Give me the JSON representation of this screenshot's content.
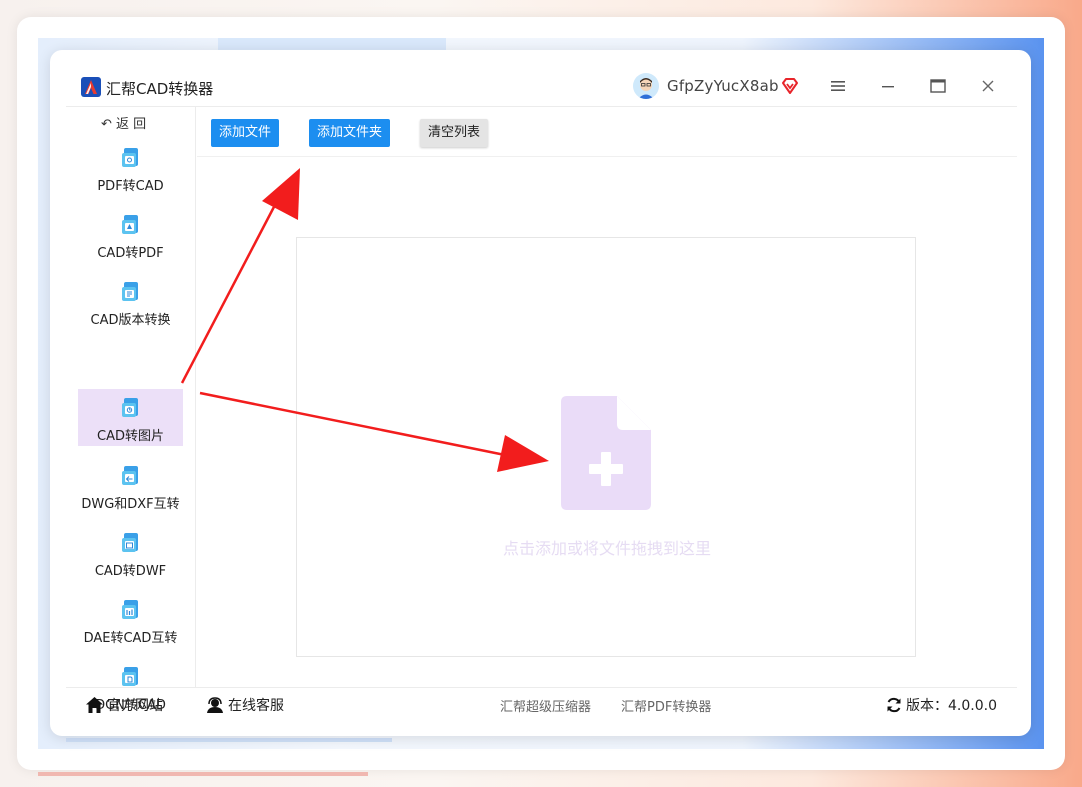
{
  "app": {
    "title": "汇帮CAD转换器",
    "user_name": "GfpZyYucX8ab"
  },
  "sidebar": {
    "back_label": "返 回",
    "items": [
      {
        "label": "PDF转CAD",
        "icon": "pdf-to-cad-icon"
      },
      {
        "label": "CAD转PDF",
        "icon": "cad-to-pdf-icon"
      },
      {
        "label": "CAD版本转换",
        "icon": "cad-version-icon"
      },
      {
        "label": "CAD转图片",
        "icon": "cad-to-image-icon",
        "active": true
      },
      {
        "label": "DWG和DXF互转",
        "icon": "dwg-dxf-icon"
      },
      {
        "label": "CAD转DWF",
        "icon": "cad-to-dwf-icon"
      },
      {
        "label": "DAE转CAD互转",
        "icon": "dae-cad-icon"
      },
      {
        "label": "DGN转CAD",
        "icon": "dgn-to-cad-icon"
      }
    ]
  },
  "toolbar": {
    "add_file": "添加文件",
    "add_folder": "添加文件夹",
    "clear_list": "清空列表"
  },
  "dropzone": {
    "hint": "点击添加或将文件拖拽到这里"
  },
  "footer": {
    "website": "官方网站",
    "support": "在线客服",
    "link1": "汇帮超级压缩器",
    "link2": "汇帮PDF转换器",
    "version": "版本：4.0.0.0"
  },
  "colors": {
    "accent_blue": "#1c8ef0",
    "active_bg": "#ece0f8",
    "drop_icon": "#eadcf8",
    "arrow_red": "#f21d1d"
  }
}
